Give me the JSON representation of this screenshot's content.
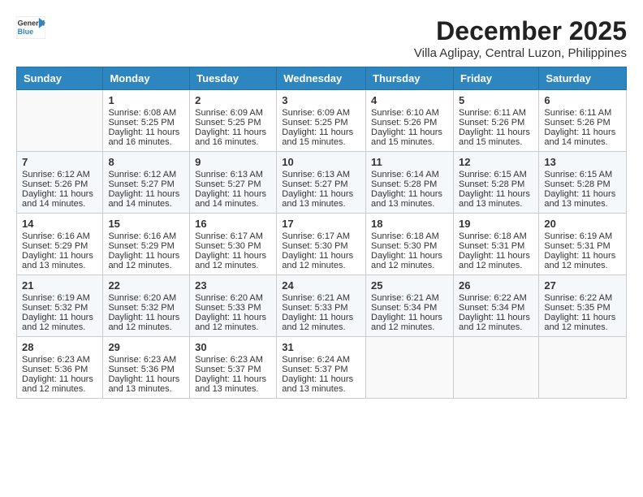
{
  "logo": {
    "general": "General",
    "blue": "Blue"
  },
  "title": "December 2025",
  "subtitle": "Villa Aglipay, Central Luzon, Philippines",
  "headers": [
    "Sunday",
    "Monday",
    "Tuesday",
    "Wednesday",
    "Thursday",
    "Friday",
    "Saturday"
  ],
  "rows": [
    [
      {
        "day": "",
        "info": ""
      },
      {
        "day": "1",
        "info": "Sunrise: 6:08 AM\nSunset: 5:25 PM\nDaylight: 11 hours and 16 minutes."
      },
      {
        "day": "2",
        "info": "Sunrise: 6:09 AM\nSunset: 5:25 PM\nDaylight: 11 hours and 16 minutes."
      },
      {
        "day": "3",
        "info": "Sunrise: 6:09 AM\nSunset: 5:25 PM\nDaylight: 11 hours and 15 minutes."
      },
      {
        "day": "4",
        "info": "Sunrise: 6:10 AM\nSunset: 5:26 PM\nDaylight: 11 hours and 15 minutes."
      },
      {
        "day": "5",
        "info": "Sunrise: 6:11 AM\nSunset: 5:26 PM\nDaylight: 11 hours and 15 minutes."
      },
      {
        "day": "6",
        "info": "Sunrise: 6:11 AM\nSunset: 5:26 PM\nDaylight: 11 hours and 14 minutes."
      }
    ],
    [
      {
        "day": "7",
        "info": "Sunrise: 6:12 AM\nSunset: 5:26 PM\nDaylight: 11 hours and 14 minutes."
      },
      {
        "day": "8",
        "info": "Sunrise: 6:12 AM\nSunset: 5:27 PM\nDaylight: 11 hours and 14 minutes."
      },
      {
        "day": "9",
        "info": "Sunrise: 6:13 AM\nSunset: 5:27 PM\nDaylight: 11 hours and 14 minutes."
      },
      {
        "day": "10",
        "info": "Sunrise: 6:13 AM\nSunset: 5:27 PM\nDaylight: 11 hours and 13 minutes."
      },
      {
        "day": "11",
        "info": "Sunrise: 6:14 AM\nSunset: 5:28 PM\nDaylight: 11 hours and 13 minutes."
      },
      {
        "day": "12",
        "info": "Sunrise: 6:15 AM\nSunset: 5:28 PM\nDaylight: 11 hours and 13 minutes."
      },
      {
        "day": "13",
        "info": "Sunrise: 6:15 AM\nSunset: 5:28 PM\nDaylight: 11 hours and 13 minutes."
      }
    ],
    [
      {
        "day": "14",
        "info": "Sunrise: 6:16 AM\nSunset: 5:29 PM\nDaylight: 11 hours and 13 minutes."
      },
      {
        "day": "15",
        "info": "Sunrise: 6:16 AM\nSunset: 5:29 PM\nDaylight: 11 hours and 12 minutes."
      },
      {
        "day": "16",
        "info": "Sunrise: 6:17 AM\nSunset: 5:30 PM\nDaylight: 11 hours and 12 minutes."
      },
      {
        "day": "17",
        "info": "Sunrise: 6:17 AM\nSunset: 5:30 PM\nDaylight: 11 hours and 12 minutes."
      },
      {
        "day": "18",
        "info": "Sunrise: 6:18 AM\nSunset: 5:30 PM\nDaylight: 11 hours and 12 minutes."
      },
      {
        "day": "19",
        "info": "Sunrise: 6:18 AM\nSunset: 5:31 PM\nDaylight: 11 hours and 12 minutes."
      },
      {
        "day": "20",
        "info": "Sunrise: 6:19 AM\nSunset: 5:31 PM\nDaylight: 11 hours and 12 minutes."
      }
    ],
    [
      {
        "day": "21",
        "info": "Sunrise: 6:19 AM\nSunset: 5:32 PM\nDaylight: 11 hours and 12 minutes."
      },
      {
        "day": "22",
        "info": "Sunrise: 6:20 AM\nSunset: 5:32 PM\nDaylight: 11 hours and 12 minutes."
      },
      {
        "day": "23",
        "info": "Sunrise: 6:20 AM\nSunset: 5:33 PM\nDaylight: 11 hours and 12 minutes."
      },
      {
        "day": "24",
        "info": "Sunrise: 6:21 AM\nSunset: 5:33 PM\nDaylight: 11 hours and 12 minutes."
      },
      {
        "day": "25",
        "info": "Sunrise: 6:21 AM\nSunset: 5:34 PM\nDaylight: 11 hours and 12 minutes."
      },
      {
        "day": "26",
        "info": "Sunrise: 6:22 AM\nSunset: 5:34 PM\nDaylight: 11 hours and 12 minutes."
      },
      {
        "day": "27",
        "info": "Sunrise: 6:22 AM\nSunset: 5:35 PM\nDaylight: 11 hours and 12 minutes."
      }
    ],
    [
      {
        "day": "28",
        "info": "Sunrise: 6:23 AM\nSunset: 5:36 PM\nDaylight: 11 hours and 12 minutes."
      },
      {
        "day": "29",
        "info": "Sunrise: 6:23 AM\nSunset: 5:36 PM\nDaylight: 11 hours and 13 minutes."
      },
      {
        "day": "30",
        "info": "Sunrise: 6:23 AM\nSunset: 5:37 PM\nDaylight: 11 hours and 13 minutes."
      },
      {
        "day": "31",
        "info": "Sunrise: 6:24 AM\nSunset: 5:37 PM\nDaylight: 11 hours and 13 minutes."
      },
      {
        "day": "",
        "info": ""
      },
      {
        "day": "",
        "info": ""
      },
      {
        "day": "",
        "info": ""
      }
    ]
  ]
}
